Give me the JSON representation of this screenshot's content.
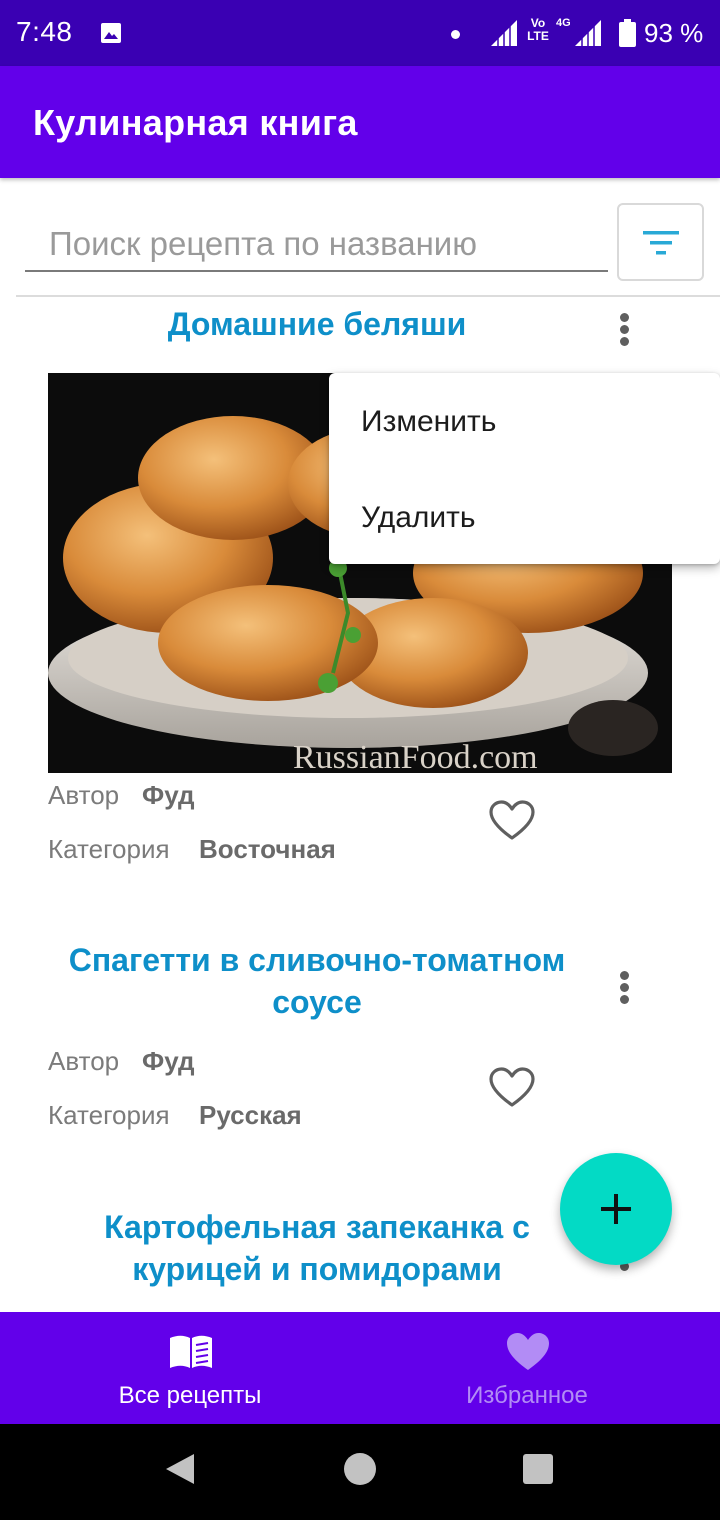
{
  "status_bar": {
    "time": "7:48",
    "volte": "Vo LTE",
    "network_4g": "4G",
    "battery": "93 %"
  },
  "app_bar": {
    "title": "Кулинарная книга"
  },
  "search": {
    "placeholder": "Поиск рецепта по названию",
    "value": ""
  },
  "labels": {
    "author": "Автор",
    "category": "Категория"
  },
  "recipes": [
    {
      "title": "Домашние беляши",
      "author": "Фуд",
      "category": "Восточная",
      "image_watermark": "RussianFood.com",
      "favorite": false
    },
    {
      "title": "Спагетти в сливочно-томатном соусе",
      "author": "Фуд",
      "category": "Русская",
      "favorite": false
    },
    {
      "title": "Картофельная запеканка с курицей и помидорами"
    }
  ],
  "popup_menu": {
    "items": [
      "Изменить",
      "Удалить"
    ]
  },
  "bottom_nav": {
    "items": [
      {
        "label": "Все рецепты",
        "icon": "book-icon",
        "active": true
      },
      {
        "label": "Избранное",
        "icon": "heart-icon",
        "active": false
      }
    ]
  },
  "colors": {
    "status_bar": "#3a00b3",
    "primary": "#6200ea",
    "accent": "#03dac5",
    "title_text": "#0e8fc9"
  }
}
